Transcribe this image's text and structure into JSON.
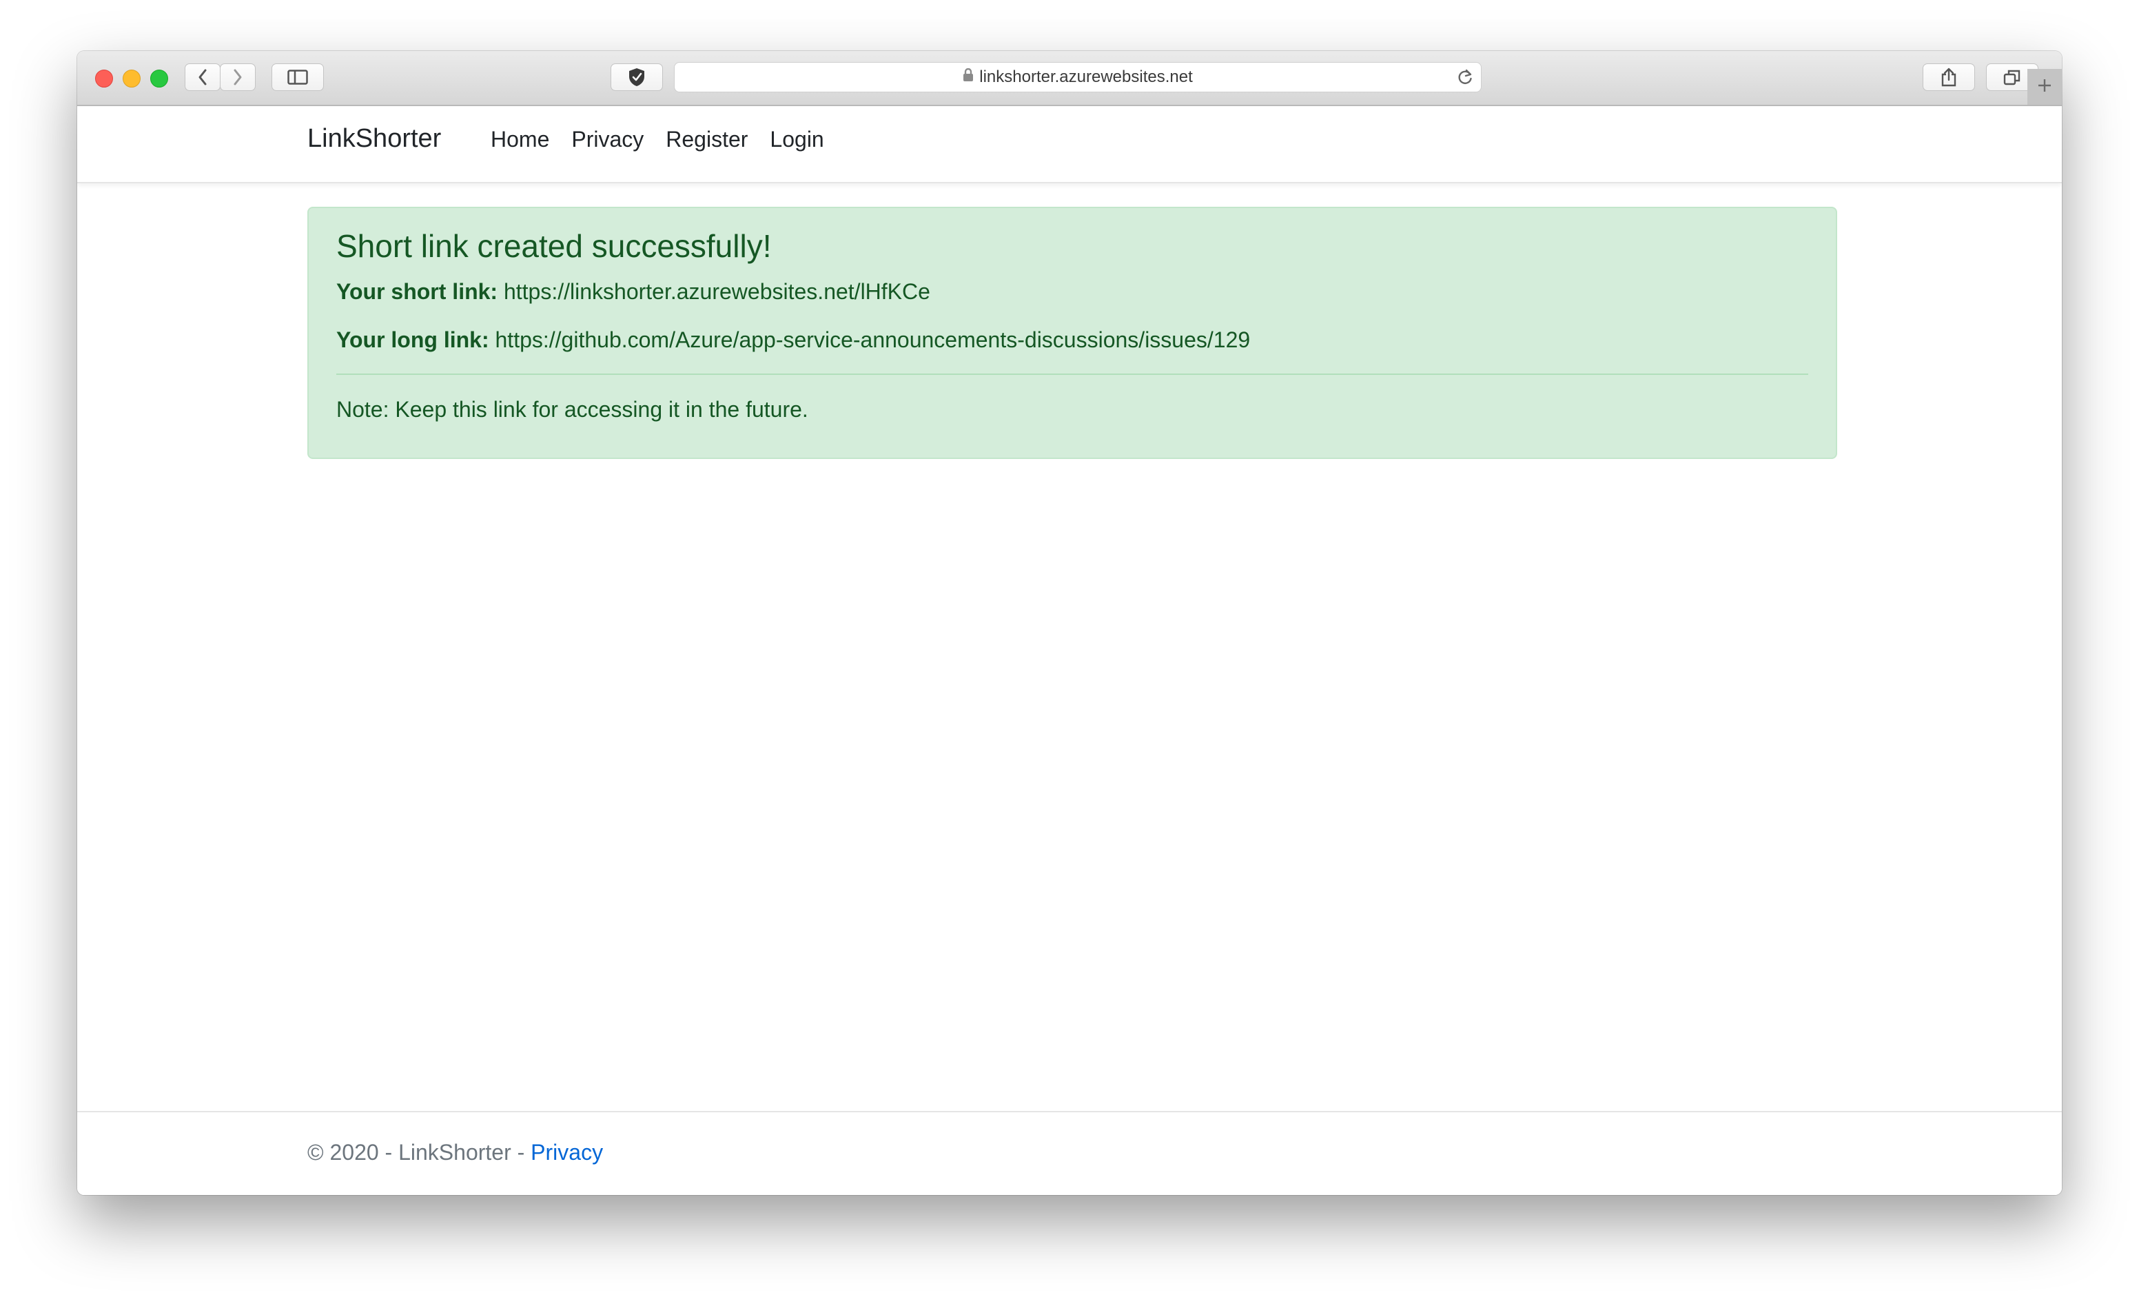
{
  "browser": {
    "url": "linkshorter.azurewebsites.net",
    "icons": {
      "back": "chevron-left-icon",
      "forward": "chevron-right-icon",
      "sidebar": "sidebar-icon",
      "privacy_shield": "shield-icon",
      "lock": "lock-icon",
      "reload": "reload-icon",
      "share": "share-icon",
      "tabs": "tabs-icon",
      "new_tab": "plus-icon"
    }
  },
  "navbar": {
    "brand": "LinkShorter",
    "links": [
      {
        "label": "Home"
      },
      {
        "label": "Privacy"
      },
      {
        "label": "Register"
      },
      {
        "label": "Login"
      }
    ]
  },
  "alert": {
    "heading": "Short link created successfully!",
    "short_label": "Your short link:",
    "short_value": "https://linkshorter.azurewebsites.net/lHfKCe",
    "long_label": "Your long link:",
    "long_value": "https://github.com/Azure/app-service-announcements-discussions/issues/129",
    "note": "Note: Keep this link for accessing it in the future.",
    "colors": {
      "background": "#d4edda",
      "border": "#c3e6cb",
      "text": "#155724"
    }
  },
  "footer": {
    "text": "© 2020 - LinkShorter - ",
    "privacy_link": "Privacy",
    "link_color": "#0366d6"
  }
}
